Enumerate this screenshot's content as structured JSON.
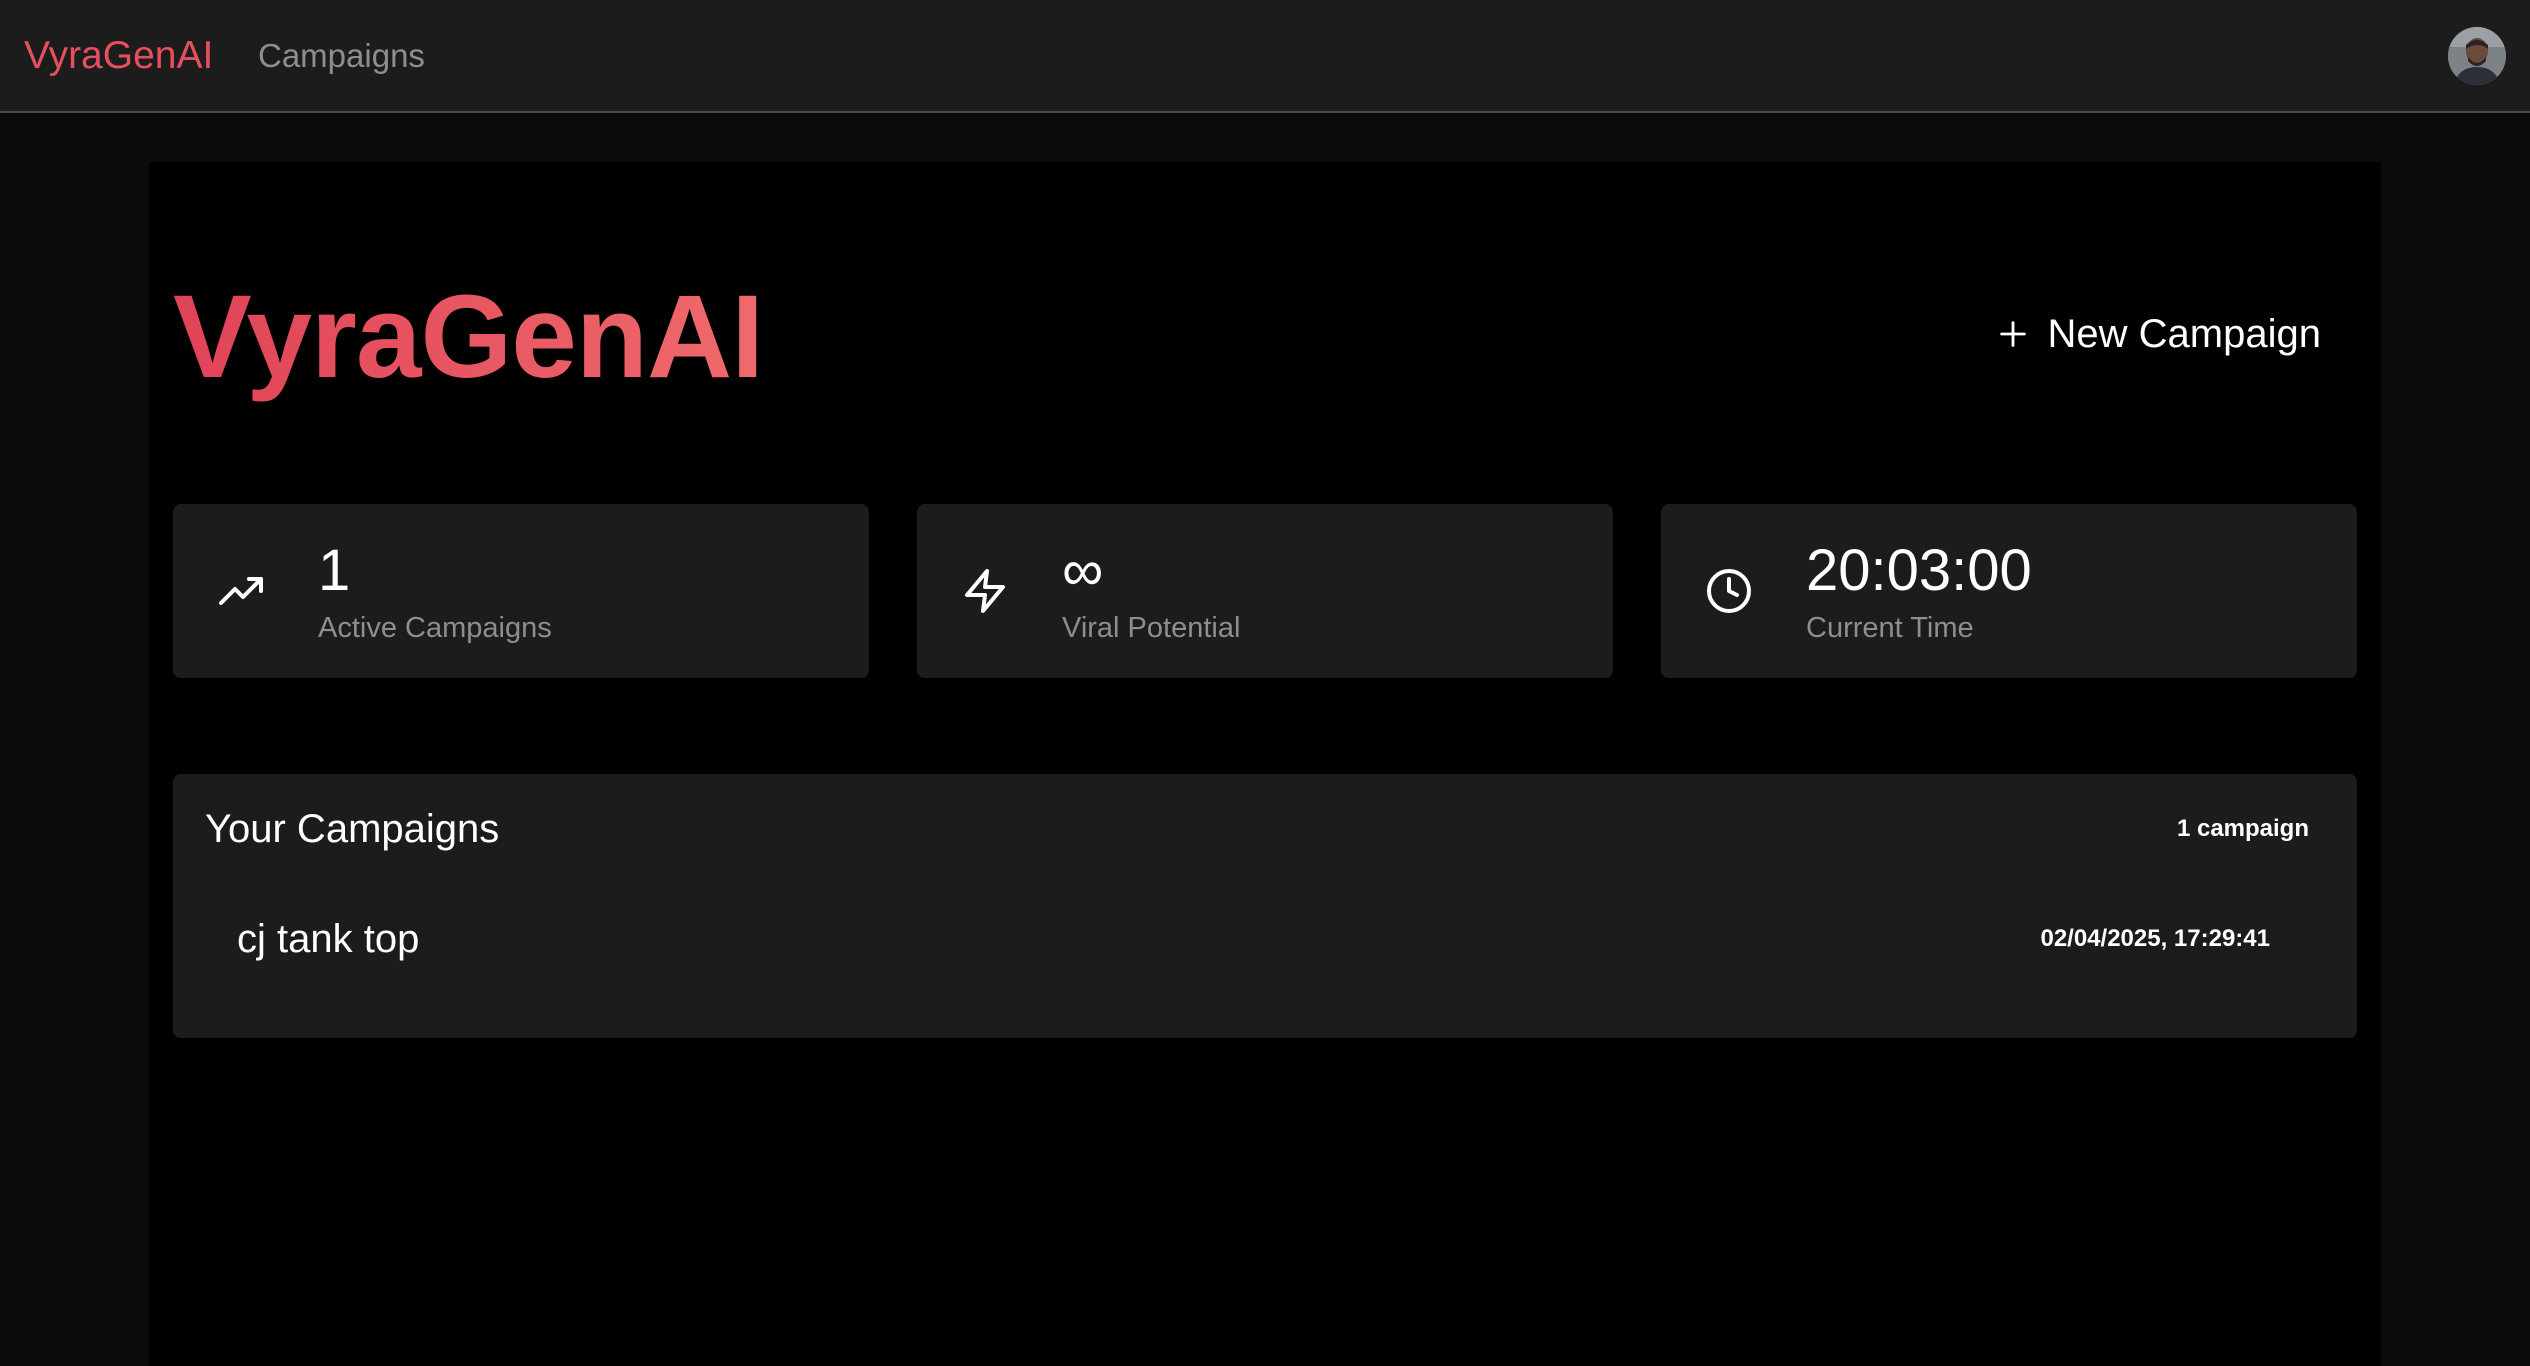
{
  "navbar": {
    "brand": "VyraGenAI",
    "links": [
      {
        "label": "Campaigns"
      }
    ],
    "avatar_icon": "user-avatar"
  },
  "hero": {
    "title": "VyraGenAI",
    "new_campaign_label": "New Campaign",
    "new_campaign_icon": "plus-icon"
  },
  "stats": [
    {
      "icon": "trending-up-icon",
      "value": "1",
      "label": "Active Campaigns"
    },
    {
      "icon": "lightning-icon",
      "value": "∞",
      "label": "Viral Potential"
    },
    {
      "icon": "clock-icon",
      "value": "20:03:00",
      "label": "Current Time"
    }
  ],
  "campaigns": {
    "title": "Your Campaigns",
    "count_label": "1 campaign",
    "items": [
      {
        "name": "cj tank top",
        "date": "02/04/2025, 17:29:41"
      }
    ]
  },
  "colors": {
    "accent": "#e5505f",
    "navbar_bg": "#1c1c1c",
    "card_bg": "#1c1c1c",
    "page_bg": "#000000",
    "muted_text": "#8e8e8e"
  }
}
